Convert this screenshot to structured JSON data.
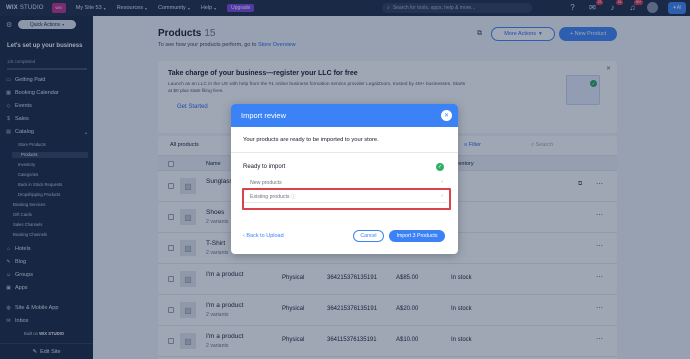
{
  "topbar": {
    "logo": "WIX",
    "logo_sub": "STUDIO",
    "site_badge": "WIX",
    "site_name": "My Site 53",
    "nav": [
      "Resources",
      "Community",
      "Help"
    ],
    "upgrade": "Upgrade",
    "search_placeholder": "Search for tools, apps, help & more...",
    "badges": [
      "23",
      "16",
      "99+"
    ],
    "ai_label": "AI"
  },
  "sidebar": {
    "quick_actions": "Quick Actions",
    "setup_title": "Let's set up your business",
    "completed": "1/5 completed",
    "items": [
      {
        "label": "Getting Paid"
      },
      {
        "label": "Booking Calendar"
      },
      {
        "label": "Events"
      },
      {
        "label": "Sales"
      },
      {
        "label": "Catalog"
      }
    ],
    "catalog_sub": [
      "Store Products",
      "Products",
      "Inventory",
      "Categories",
      "Back in Stock Requests",
      "Dropshipping Products",
      "Booking Services",
      "Gift Cards",
      "Sales Channels",
      "Booking Channels"
    ],
    "items_lower": [
      {
        "label": "Hotels"
      },
      {
        "label": "Blog"
      },
      {
        "label": "Groups"
      },
      {
        "label": "Apps"
      },
      {
        "label": "Site & Mobile App"
      },
      {
        "label": "Inbox"
      }
    ],
    "built_on": "Built on",
    "built_on_brand": "WIX STUDIO",
    "edit_site": "Edit Site"
  },
  "main": {
    "title": "Products",
    "count": "15",
    "subtitle": "To see how your products perform, go to",
    "subtitle_link": "Store Overview",
    "more_actions": "More Actions",
    "new_product": "+ New Product",
    "banner": {
      "title": "Take charge of your business—register your LLC for free",
      "text": "Launch as an LLC in the US with help from the #1 online business formation service provider LegalZoom, trusted by 4M+ businesses. Starts at $0 plus state filing fees.",
      "link": "Get Started"
    },
    "table": {
      "tab": "All products",
      "filter": "Filter",
      "search": "Search",
      "headers": [
        "Name",
        "Inventory"
      ],
      "rows": [
        {
          "name": "Sunglasses",
          "variants": "",
          "type": "",
          "sku": "",
          "price": "",
          "stock": ""
        },
        {
          "name": "Shoes",
          "variants": "2 variants",
          "type": "",
          "sku": "",
          "price": "",
          "stock": ""
        },
        {
          "name": "T-Shirt",
          "variants": "2 variants",
          "type": "",
          "sku": "",
          "price": "",
          "stock": ""
        },
        {
          "name": "I'm a product",
          "variants": "",
          "type": "Physical",
          "sku": "364215376135191",
          "price": "A$85.00",
          "stock": "In stock"
        },
        {
          "name": "I'm a product",
          "variants": "2 variants",
          "type": "Physical",
          "sku": "364215376135191",
          "price": "A$20.00",
          "stock": "In stock"
        },
        {
          "name": "I'm a product",
          "variants": "2 variants",
          "type": "Physical",
          "sku": "364115376135191",
          "price": "A$10.00",
          "stock": "In stock"
        }
      ]
    }
  },
  "modal": {
    "title": "Import review",
    "message": "Your products are ready to be imported to your store.",
    "ready": "Ready to import",
    "new_products": "New products",
    "existing_products": "Existing products",
    "back": "Back to Upload",
    "cancel": "Cancel",
    "import": "Import 3 Products"
  },
  "colors": {
    "topbar": "#1b2640",
    "sidebar": "#16223a",
    "accent": "#3b82f6",
    "highlight": "#d9434b",
    "success": "#2fb064"
  }
}
